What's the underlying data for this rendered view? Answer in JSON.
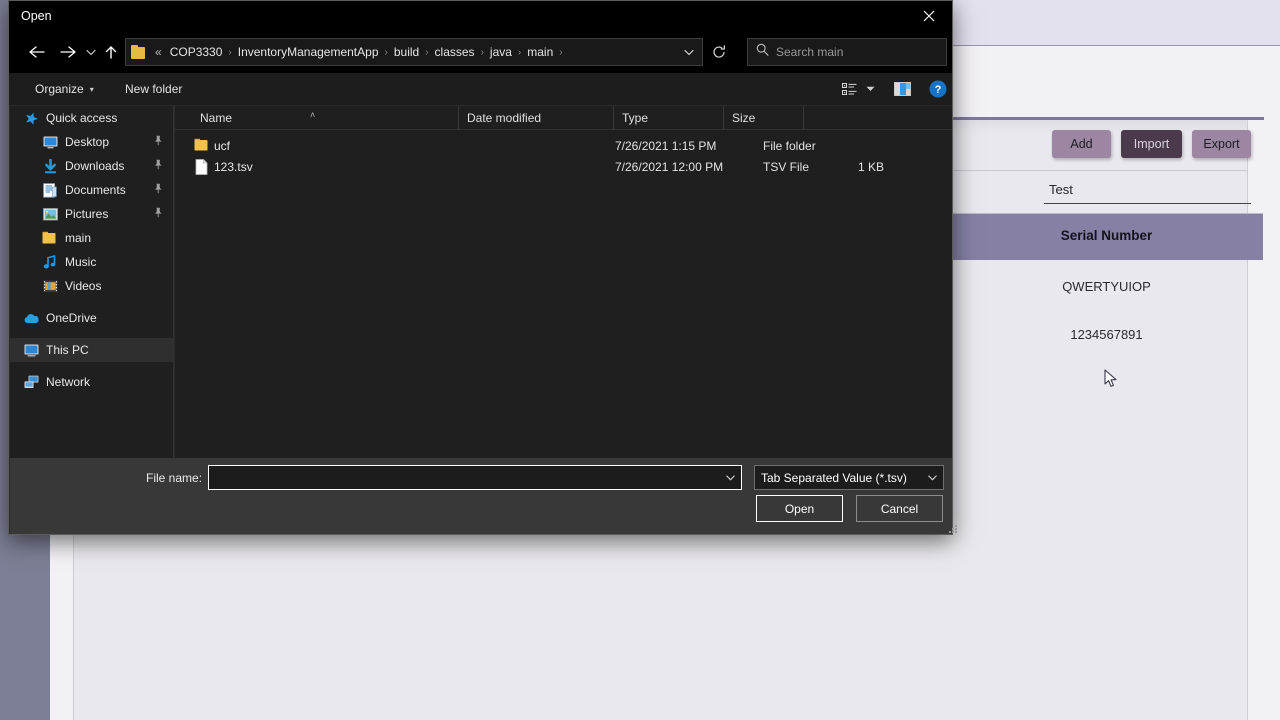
{
  "dialog": {
    "title": "Open",
    "close_label": "✕",
    "nav": {
      "back_label": "←",
      "forward_label": "→",
      "recent_label": "˅",
      "up_label": "↑",
      "refresh_label": "↻",
      "dropdown_label": "˅"
    },
    "address": {
      "lead": "«",
      "separator": "›",
      "crumbs": [
        "COP3330",
        "InventoryManagementApp",
        "build",
        "classes",
        "java",
        "main"
      ]
    },
    "search": {
      "placeholder": "Search main",
      "value": ""
    },
    "toolbar": {
      "organize": "Organize",
      "organize_caret": "▾",
      "new_folder": "New folder",
      "view_caret": "▾",
      "help_label": "?"
    },
    "navpane": {
      "items": [
        {
          "label": "Quick access",
          "icon": "star-icon",
          "level": "group",
          "pinned": false,
          "selected": false
        },
        {
          "label": "Desktop",
          "icon": "desktop-icon",
          "level": "child",
          "pinned": true,
          "selected": false
        },
        {
          "label": "Downloads",
          "icon": "download-icon",
          "level": "child",
          "pinned": true,
          "selected": false
        },
        {
          "label": "Documents",
          "icon": "documents-icon",
          "level": "child",
          "pinned": true,
          "selected": false
        },
        {
          "label": "Pictures",
          "icon": "pictures-icon",
          "level": "child",
          "pinned": true,
          "selected": false
        },
        {
          "label": "main",
          "icon": "folder-icon",
          "level": "child",
          "pinned": false,
          "selected": false
        },
        {
          "label": "Music",
          "icon": "music-icon",
          "level": "child",
          "pinned": false,
          "selected": false
        },
        {
          "label": "Videos",
          "icon": "videos-icon",
          "level": "child",
          "pinned": false,
          "selected": false
        },
        {
          "label": "OneDrive",
          "icon": "onedrive-icon",
          "level": "group",
          "pinned": false,
          "selected": false
        },
        {
          "label": "This PC",
          "icon": "thispc-icon",
          "level": "group",
          "pinned": false,
          "selected": true
        },
        {
          "label": "Network",
          "icon": "network-icon",
          "level": "group",
          "pinned": false,
          "selected": false
        }
      ]
    },
    "filelist": {
      "columns": [
        "Name",
        "Date modified",
        "Type",
        "Size"
      ],
      "sort_caret": "˄",
      "rows": [
        {
          "name": "ucf",
          "date": "7/26/2021 1:15 PM",
          "type": "File folder",
          "size": "",
          "icon": "folder-icon"
        },
        {
          "name": "123.tsv",
          "date": "7/26/2021 12:00 PM",
          "type": "TSV File",
          "size": "1 KB",
          "icon": "file-icon"
        }
      ]
    },
    "footer": {
      "filename_label": "File name:",
      "filename_value": "",
      "filename_placeholder": "",
      "filename_caret": "˅",
      "filter_value": "Tab Separated Value (*.tsv)",
      "filter_caret": "˅",
      "open_label": "Open",
      "cancel_label": "Cancel"
    }
  },
  "background_app": {
    "buttons": {
      "add": "Add",
      "import": "Import",
      "export": "Export"
    },
    "search_field_value": "Test",
    "table": {
      "header": "Serial Number",
      "rows": [
        "QWERTYUIOP",
        "1234567891"
      ]
    },
    "colors": {
      "accent": "#8680a5",
      "button": "#9c86a2",
      "button_active": "#4a3a4c",
      "panel": "#7c7f95",
      "surface": "#e9e8ee"
    }
  }
}
